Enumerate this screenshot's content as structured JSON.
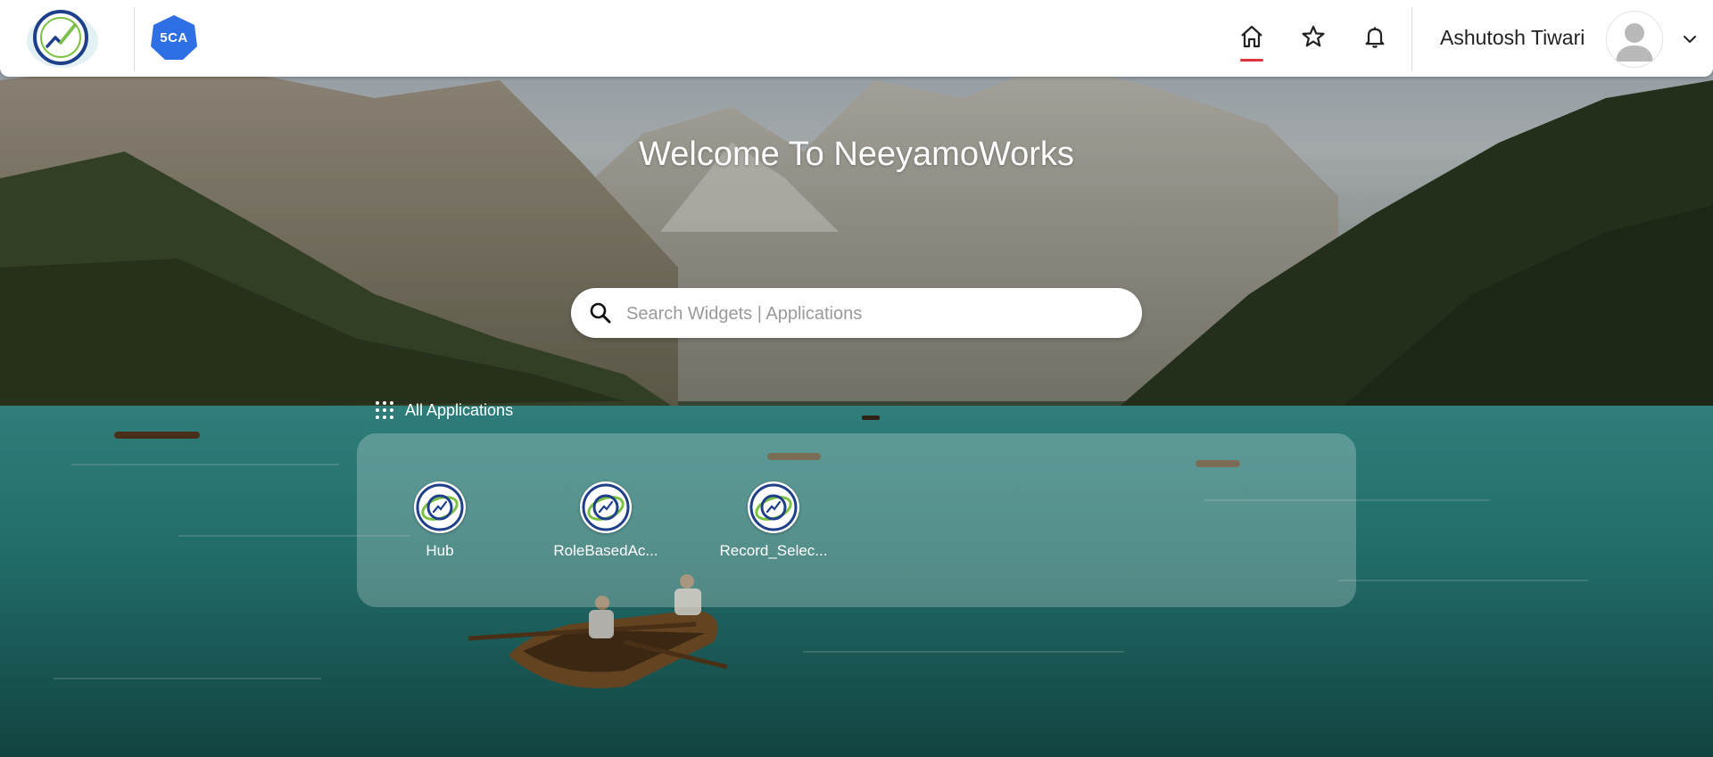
{
  "header": {
    "brand_5ca": "5CA",
    "user_name": "Ashutosh Tiwari",
    "nav": [
      {
        "name": "home-icon",
        "active": true
      },
      {
        "name": "star-icon",
        "active": false
      },
      {
        "name": "bell-icon",
        "active": false
      }
    ],
    "accent_color": "#e0343a"
  },
  "main": {
    "welcome_title": "Welcome To NeeyamoWorks",
    "search": {
      "placeholder": "Search Widgets | Applications",
      "value": ""
    },
    "apps_section_label": "All Applications",
    "apps": [
      {
        "label": "Hub"
      },
      {
        "label": "RoleBasedAc..."
      },
      {
        "label": "Record_Selec..."
      }
    ]
  }
}
